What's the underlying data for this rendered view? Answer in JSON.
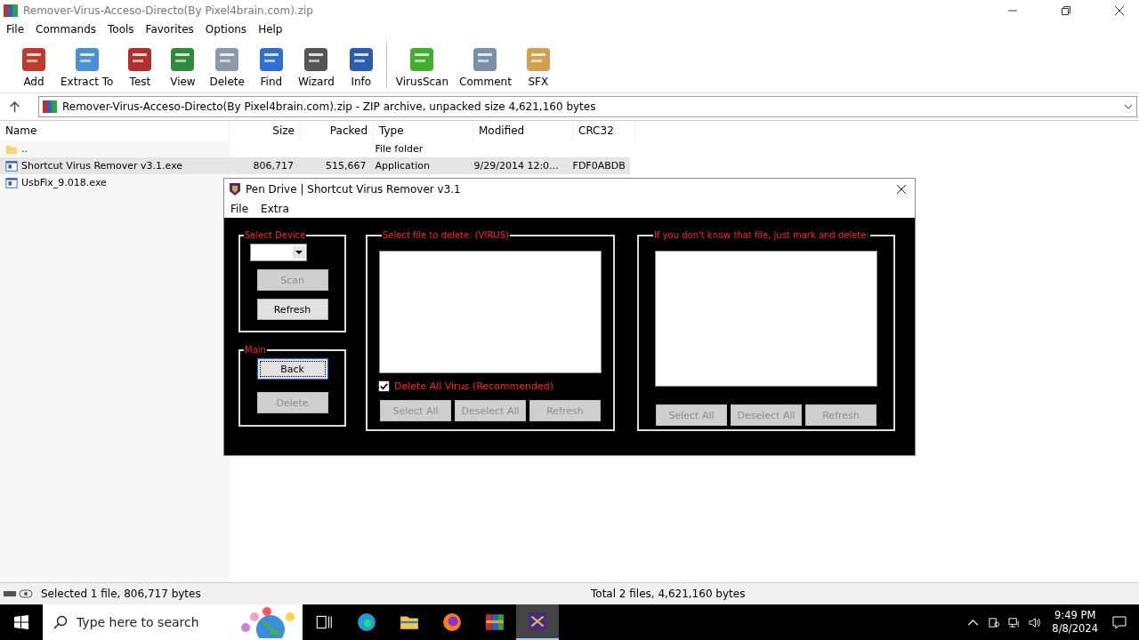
{
  "window": {
    "title": "Remover-Virus-Acceso-Directo(By Pixel4brain.com).zip"
  },
  "menu": [
    "File",
    "Commands",
    "Tools",
    "Favorites",
    "Options",
    "Help"
  ],
  "toolbar": [
    [
      "Add",
      "Extract To",
      "Test",
      "View",
      "Delete",
      "Find",
      "Wizard",
      "Info"
    ],
    [
      "VirusScan",
      "Comment",
      "SFX"
    ]
  ],
  "address": "Remover-Virus-Acceso-Directo(By Pixel4brain.com).zip - ZIP archive, unpacked size 4,621,160 bytes",
  "columns": [
    "Name",
    "Size",
    "Packed",
    "Type",
    "Modified",
    "CRC32"
  ],
  "files": [
    {
      "kind": "folder",
      "name": "..",
      "type": "File folder",
      "selected": false
    },
    {
      "kind": "exe",
      "name": "Shortcut Virus Remover v3.1.exe",
      "size": "806,717",
      "packed": "515,667",
      "type": "Application",
      "modified": "9/29/2014 12:0...",
      "crc": "FDF0ABDB",
      "selected": true
    },
    {
      "kind": "exe",
      "name": "UsbFix_9.018.exe",
      "selected": false
    }
  ],
  "status_bar": {
    "left": "Selected 1 file, 806,717 bytes",
    "right": "Total 2 files, 4,621,160 bytes"
  },
  "dialog": {
    "title": "Pen Drive | Shortcut Virus Remover v3.1",
    "menu": [
      "File",
      "Extra"
    ],
    "device_group": {
      "title": "Select Device",
      "buttons": [
        {
          "label": "Scan",
          "disabled": true,
          "focused": false
        },
        {
          "label": "Refresh",
          "disabled": false,
          "focused": false
        }
      ]
    },
    "main_group": {
      "title": "Main",
      "buttons": [
        {
          "label": "Back",
          "disabled": false,
          "focused": true
        },
        {
          "label": "Delete",
          "disabled": true,
          "focused": false
        }
      ]
    },
    "virus_group": {
      "title": "Select file to delete: (VIRUS)",
      "checkbox": {
        "label": "Delete All Virus (Recommended)",
        "checked": true
      },
      "buttons": [
        {
          "label": "Select All",
          "disabled": true,
          "focused": false
        },
        {
          "label": "Deselect All",
          "disabled": true,
          "focused": false
        },
        {
          "label": "Refresh",
          "disabled": true,
          "focused": false
        }
      ]
    },
    "unknown_group": {
      "title": "If you don't know that file, just mark and delete:",
      "buttons": [
        {
          "label": "Select All",
          "disabled": true,
          "focused": false
        },
        {
          "label": "Deselect All",
          "disabled": true,
          "focused": false
        },
        {
          "label": "Refresh",
          "disabled": true,
          "focused": false
        }
      ]
    }
  },
  "taskbar": {
    "search_placeholder": "Type here to search",
    "time": "9:49 PM",
    "date": "8/8/2024"
  }
}
